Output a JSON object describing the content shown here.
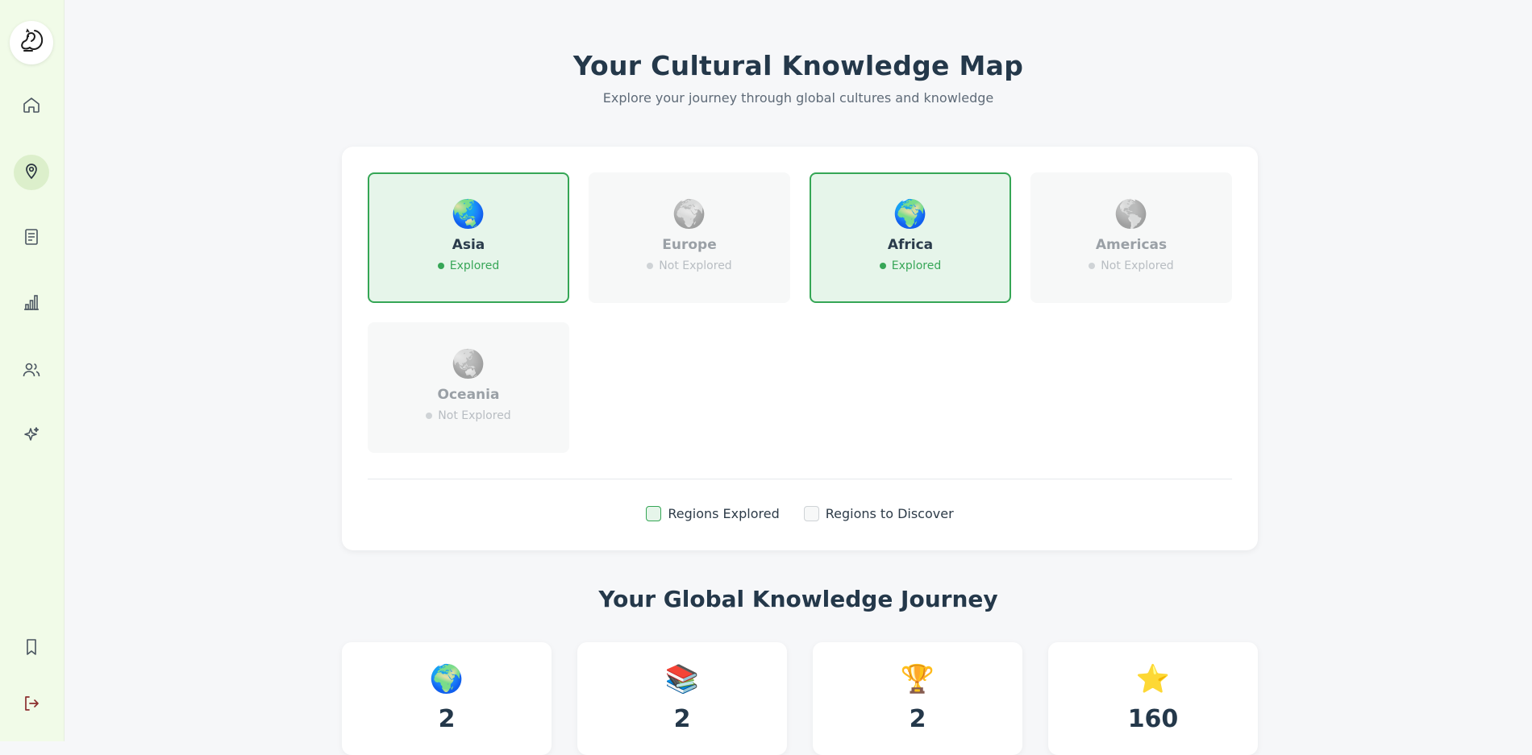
{
  "sidebar": {
    "logo_icon": "squirrel-icon",
    "nav": [
      {
        "icon": "home-icon",
        "active": false
      },
      {
        "icon": "map-pin-icon",
        "active": true
      },
      {
        "icon": "document-icon",
        "active": false
      },
      {
        "icon": "bar-chart-icon",
        "active": false
      },
      {
        "icon": "users-icon",
        "active": false
      },
      {
        "icon": "sparkles-icon",
        "active": false
      }
    ],
    "bottom": [
      {
        "icon": "bookmark-icon"
      },
      {
        "icon": "logout-icon"
      }
    ]
  },
  "header": {
    "title": "Your Cultural Knowledge Map",
    "subtitle": "Explore your journey through global cultures and knowledge"
  },
  "regions": [
    {
      "name": "Asia",
      "status": "Explored",
      "explored": true,
      "icon": "🌏"
    },
    {
      "name": "Europe",
      "status": "Not Explored",
      "explored": false,
      "icon": "🌍"
    },
    {
      "name": "Africa",
      "status": "Explored",
      "explored": true,
      "icon": "🌍"
    },
    {
      "name": "Americas",
      "status": "Not Explored",
      "explored": false,
      "icon": "🌎"
    },
    {
      "name": "Oceania",
      "status": "Not Explored",
      "explored": false,
      "icon": "🌏"
    }
  ],
  "legend": {
    "explored": "Regions Explored",
    "to_discover": "Regions to Discover"
  },
  "journey": {
    "title": "Your Global Knowledge Journey",
    "stats": [
      {
        "icon": "🌍",
        "value": "2"
      },
      {
        "icon": "📚",
        "value": "2"
      },
      {
        "icon": "🏆",
        "value": "2"
      },
      {
        "icon": "⭐",
        "value": "160"
      }
    ]
  },
  "colors": {
    "accent_green": "#35a655",
    "explored_bg": "#e6f5ea",
    "sidebar_bg": "#f1fbe8",
    "logout_red": "#8b2e2e"
  }
}
